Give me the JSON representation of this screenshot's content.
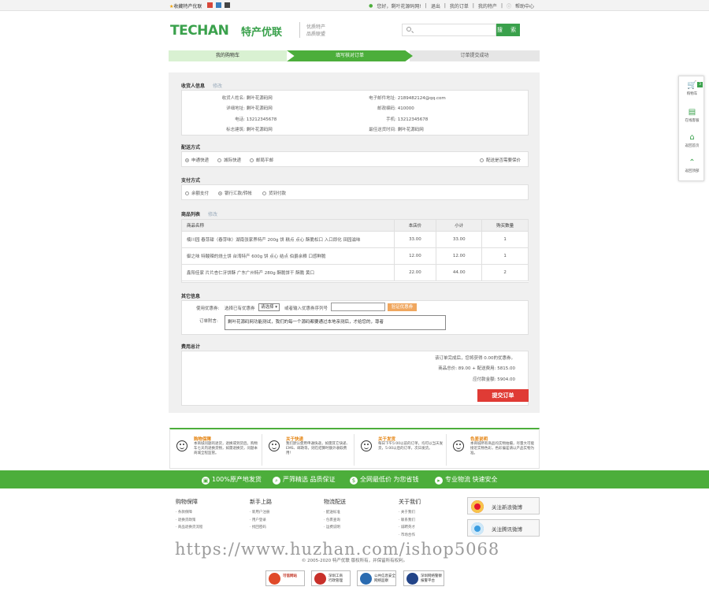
{
  "topbar": {
    "favorite": "收藏特产优联",
    "greeting": "您好，剩叶花源码网!",
    "logout": "退出",
    "my_orders": "我的订单",
    "my_specialty": "我的特产",
    "help": "帮助中心"
  },
  "header": {
    "logo": "TECHAN",
    "logo_cn": "特产优联",
    "tagline_1": "优质特产",
    "tagline_2": "品质联盟",
    "search_placeholder": "",
    "search_button": "搜 索"
  },
  "steps": [
    "我的购物车",
    "填写核对订单",
    "订单提交成功"
  ],
  "consignee": {
    "title": "收货人信息",
    "edit": "修改",
    "name_label": "收货人姓名:",
    "name": "剩叶花源码网",
    "email_label": "电子邮件地址:",
    "email": "2189482124@qq.com",
    "address_label": "详细地址:",
    "address": "剩叶花源码网",
    "zip_label": "邮政编码:",
    "zip": "410000",
    "phone_label": "电话:",
    "phone": "13212345678",
    "mobile_label": "手机:",
    "mobile": "13212345678",
    "building_label": "标志建筑:",
    "building": "剩叶花源码网",
    "best_time_label": "最佳送货时间:",
    "best_time": "剩叶花源码网"
  },
  "shipping": {
    "title": "配送方式",
    "options": [
      "申通快递",
      "城际快递",
      "邮局平邮"
    ],
    "selected": 0,
    "insure": "配送是否需要保价"
  },
  "payment": {
    "title": "支付方式",
    "options": [
      "余额支付",
      "银行汇款/转帐",
      "货到付款"
    ],
    "selected": 1
  },
  "goods": {
    "title": "商品列表",
    "edit": "修改",
    "headers": [
      "商品名称",
      "本店价",
      "小计",
      "购买数量"
    ],
    "rows": [
      {
        "name": "楠川园 春芽甜（春芽味）湖南张家界特产 200g 饼 糕点 点心 酥脆松口 入口即化 田园滋味",
        "price": "33.00",
        "subtotal": "33.00",
        "qty": "1"
      },
      {
        "name": "御之味 特酸辣的烧土饼 台湾特产 600g 饼 点心 结点 伯爵余粮 口感鲜脆",
        "price": "12.00",
        "subtotal": "12.00",
        "qty": "1"
      },
      {
        "name": "鑫阳佳家 片片杏仁牙饼酥 广东广州特产 280g 酥脆饼干 酥脆 黄口",
        "price": "22.00",
        "subtotal": "44.00",
        "qty": "2"
      }
    ]
  },
  "other": {
    "title": "其它信息",
    "coupon_label": "使用优惠券:",
    "coupon_hint": "选择已有优惠券",
    "coupon_select": "请选择",
    "coupon_or": "或者输入优惠券序列号",
    "coupon_button": "验证优惠券",
    "memo_label": "订单附言:",
    "memo": "剩叶花源码网功能测试，我们的每一个源码都要通过本地亲测后，才给您的，尊者"
  },
  "totals": {
    "title": "费用总计",
    "line1": "该订单完成后，您将获得 0.00的优惠券。",
    "line2": "商品总价: 89.00 + 配送费用: 5815.00",
    "line3": "应付款金额: 5904.00",
    "submit": "提交订单"
  },
  "side": {
    "cart": "购物车",
    "cart_count": "3",
    "service": "在线客服",
    "home": "返回首页",
    "top": "返回顶部"
  },
  "features": [
    {
      "title": "购物保障",
      "desc": "本商城问题的退货，退换或到货后。购物车七天内退换货物，如需退换货，问题本商城全程监管。"
    },
    {
      "title": "关于快递",
      "desc": "我们默认使用申通快递，如需其它快递、EMS、邮政等，则在结算时额外收取费用！"
    },
    {
      "title": "关于发货",
      "desc": "每日下午5:00以前的订单，均可以当天发货，5:00以后的订单，次日发货。"
    },
    {
      "title": "色差说明",
      "desc": "本商城所有商品均实物拍摄，尽量大可能接近实物色彩，色彩偏差请以产品实物为准。"
    }
  ],
  "promo": [
    "100%原产地发货",
    "严筛精选 品质保证",
    "全网最低价 为您省钱",
    "专业物流 快速安全"
  ],
  "footer": {
    "cols": [
      {
        "title": "购物保障",
        "links": [
          "条款保障",
          "退换货政策",
          "商品退换货流程"
        ]
      },
      {
        "title": "新手上路",
        "links": [
          "新用户注册",
          "用户登录",
          "找回密码"
        ]
      },
      {
        "title": "物流配送",
        "links": [
          "配送标准",
          "包裹查询",
          "运费说明"
        ]
      },
      {
        "title": "关于我们",
        "links": [
          "关于我们",
          "联系我们",
          "诚聘英才",
          "市场合作"
        ]
      }
    ],
    "weibo_sina": "关注新浪微博",
    "weibo_tencent": "关注腾讯微博",
    "watermark": "https://www.huzhan.com/ishop5068",
    "copyright": "© 2005-2020 特产优联 版权所有，并保留所有权利。",
    "badges": [
      "可信网站",
      "深圳工商\n行政管理",
      "公共信息安全\n网络监察",
      "深圳网络警察\n报警平台"
    ]
  }
}
